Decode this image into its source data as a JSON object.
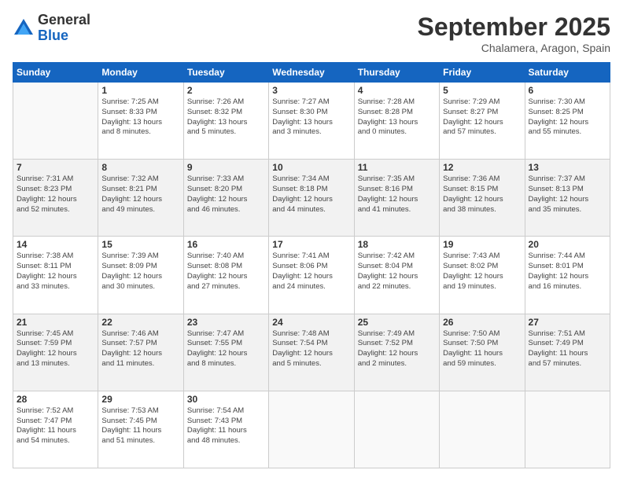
{
  "header": {
    "logo_line1": "General",
    "logo_line2": "Blue",
    "month": "September 2025",
    "location": "Chalamera, Aragon, Spain"
  },
  "weekdays": [
    "Sunday",
    "Monday",
    "Tuesday",
    "Wednesday",
    "Thursday",
    "Friday",
    "Saturday"
  ],
  "weeks": [
    [
      {
        "day": "",
        "info": ""
      },
      {
        "day": "1",
        "info": "Sunrise: 7:25 AM\nSunset: 8:33 PM\nDaylight: 13 hours\nand 8 minutes."
      },
      {
        "day": "2",
        "info": "Sunrise: 7:26 AM\nSunset: 8:32 PM\nDaylight: 13 hours\nand 5 minutes."
      },
      {
        "day": "3",
        "info": "Sunrise: 7:27 AM\nSunset: 8:30 PM\nDaylight: 13 hours\nand 3 minutes."
      },
      {
        "day": "4",
        "info": "Sunrise: 7:28 AM\nSunset: 8:28 PM\nDaylight: 13 hours\nand 0 minutes."
      },
      {
        "day": "5",
        "info": "Sunrise: 7:29 AM\nSunset: 8:27 PM\nDaylight: 12 hours\nand 57 minutes."
      },
      {
        "day": "6",
        "info": "Sunrise: 7:30 AM\nSunset: 8:25 PM\nDaylight: 12 hours\nand 55 minutes."
      }
    ],
    [
      {
        "day": "7",
        "info": "Sunrise: 7:31 AM\nSunset: 8:23 PM\nDaylight: 12 hours\nand 52 minutes."
      },
      {
        "day": "8",
        "info": "Sunrise: 7:32 AM\nSunset: 8:21 PM\nDaylight: 12 hours\nand 49 minutes."
      },
      {
        "day": "9",
        "info": "Sunrise: 7:33 AM\nSunset: 8:20 PM\nDaylight: 12 hours\nand 46 minutes."
      },
      {
        "day": "10",
        "info": "Sunrise: 7:34 AM\nSunset: 8:18 PM\nDaylight: 12 hours\nand 44 minutes."
      },
      {
        "day": "11",
        "info": "Sunrise: 7:35 AM\nSunset: 8:16 PM\nDaylight: 12 hours\nand 41 minutes."
      },
      {
        "day": "12",
        "info": "Sunrise: 7:36 AM\nSunset: 8:15 PM\nDaylight: 12 hours\nand 38 minutes."
      },
      {
        "day": "13",
        "info": "Sunrise: 7:37 AM\nSunset: 8:13 PM\nDaylight: 12 hours\nand 35 minutes."
      }
    ],
    [
      {
        "day": "14",
        "info": "Sunrise: 7:38 AM\nSunset: 8:11 PM\nDaylight: 12 hours\nand 33 minutes."
      },
      {
        "day": "15",
        "info": "Sunrise: 7:39 AM\nSunset: 8:09 PM\nDaylight: 12 hours\nand 30 minutes."
      },
      {
        "day": "16",
        "info": "Sunrise: 7:40 AM\nSunset: 8:08 PM\nDaylight: 12 hours\nand 27 minutes."
      },
      {
        "day": "17",
        "info": "Sunrise: 7:41 AM\nSunset: 8:06 PM\nDaylight: 12 hours\nand 24 minutes."
      },
      {
        "day": "18",
        "info": "Sunrise: 7:42 AM\nSunset: 8:04 PM\nDaylight: 12 hours\nand 22 minutes."
      },
      {
        "day": "19",
        "info": "Sunrise: 7:43 AM\nSunset: 8:02 PM\nDaylight: 12 hours\nand 19 minutes."
      },
      {
        "day": "20",
        "info": "Sunrise: 7:44 AM\nSunset: 8:01 PM\nDaylight: 12 hours\nand 16 minutes."
      }
    ],
    [
      {
        "day": "21",
        "info": "Sunrise: 7:45 AM\nSunset: 7:59 PM\nDaylight: 12 hours\nand 13 minutes."
      },
      {
        "day": "22",
        "info": "Sunrise: 7:46 AM\nSunset: 7:57 PM\nDaylight: 12 hours\nand 11 minutes."
      },
      {
        "day": "23",
        "info": "Sunrise: 7:47 AM\nSunset: 7:55 PM\nDaylight: 12 hours\nand 8 minutes."
      },
      {
        "day": "24",
        "info": "Sunrise: 7:48 AM\nSunset: 7:54 PM\nDaylight: 12 hours\nand 5 minutes."
      },
      {
        "day": "25",
        "info": "Sunrise: 7:49 AM\nSunset: 7:52 PM\nDaylight: 12 hours\nand 2 minutes."
      },
      {
        "day": "26",
        "info": "Sunrise: 7:50 AM\nSunset: 7:50 PM\nDaylight: 11 hours\nand 59 minutes."
      },
      {
        "day": "27",
        "info": "Sunrise: 7:51 AM\nSunset: 7:49 PM\nDaylight: 11 hours\nand 57 minutes."
      }
    ],
    [
      {
        "day": "28",
        "info": "Sunrise: 7:52 AM\nSunset: 7:47 PM\nDaylight: 11 hours\nand 54 minutes."
      },
      {
        "day": "29",
        "info": "Sunrise: 7:53 AM\nSunset: 7:45 PM\nDaylight: 11 hours\nand 51 minutes."
      },
      {
        "day": "30",
        "info": "Sunrise: 7:54 AM\nSunset: 7:43 PM\nDaylight: 11 hours\nand 48 minutes."
      },
      {
        "day": "",
        "info": ""
      },
      {
        "day": "",
        "info": ""
      },
      {
        "day": "",
        "info": ""
      },
      {
        "day": "",
        "info": ""
      }
    ]
  ]
}
